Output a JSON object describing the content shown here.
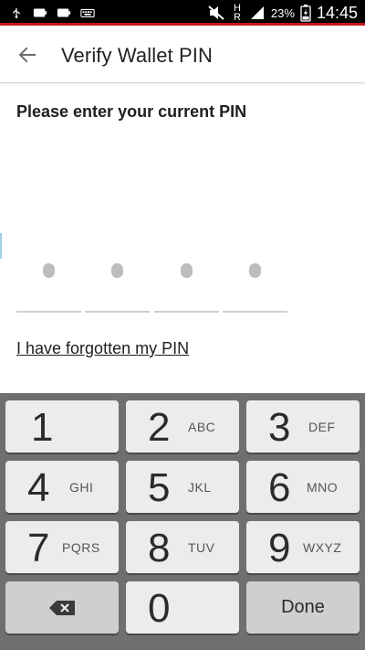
{
  "status_bar": {
    "left_icons": [
      "usb-icon",
      "notification-icon",
      "notification-icon",
      "keyboard-icon"
    ],
    "right_icons": [
      "mute-icon",
      "network-icon",
      "signal-icon",
      "battery-icon"
    ],
    "network_label": "H R",
    "battery_percent": "23%",
    "time": "14:45",
    "accent_color": "#c8161d"
  },
  "app_bar": {
    "back_icon": "arrow-left-icon",
    "title": "Verify Wallet PIN"
  },
  "main": {
    "prompt": "Please enter your current PIN",
    "pin_slots": 4,
    "forgot_link": "I have forgotten my PIN"
  },
  "keypad": {
    "keys": [
      {
        "digit": "1",
        "letters": ""
      },
      {
        "digit": "2",
        "letters": "ABC"
      },
      {
        "digit": "3",
        "letters": "DEF"
      },
      {
        "digit": "4",
        "letters": "GHI"
      },
      {
        "digit": "5",
        "letters": "JKL"
      },
      {
        "digit": "6",
        "letters": "MNO"
      },
      {
        "digit": "7",
        "letters": "PQRS"
      },
      {
        "digit": "8",
        "letters": "TUV"
      },
      {
        "digit": "9",
        "letters": "WXYZ"
      },
      {
        "digit": "0",
        "letters": ""
      }
    ],
    "backspace_icon": "backspace-icon",
    "done_label": "Done"
  }
}
